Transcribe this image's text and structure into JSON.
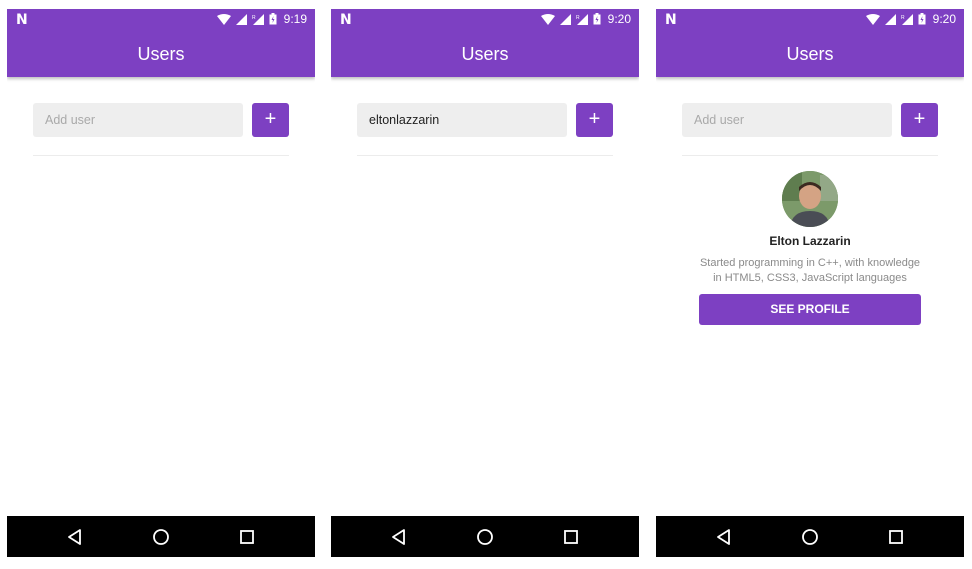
{
  "theme": {
    "primary": "#7d40c2",
    "navbar": "#000000",
    "input_bg": "#eeeeee"
  },
  "screens": [
    {
      "status": {
        "carrier_icon": "n-logo",
        "time": "9:19"
      },
      "header": {
        "title": "Users"
      },
      "form": {
        "input_value": "",
        "input_placeholder": "Add user",
        "add_label": "+"
      },
      "nav": {
        "back_icon": "back-icon",
        "home_icon": "home-icon",
        "recents_icon": "recents-icon"
      }
    },
    {
      "status": {
        "carrier_icon": "n-logo",
        "time": "9:20"
      },
      "header": {
        "title": "Users"
      },
      "form": {
        "input_value": "eltonlazzarin",
        "input_placeholder": "Add user",
        "add_label": "+"
      },
      "nav": {
        "back_icon": "back-icon",
        "home_icon": "home-icon",
        "recents_icon": "recents-icon"
      }
    },
    {
      "status": {
        "carrier_icon": "n-logo",
        "time": "9:20"
      },
      "header": {
        "title": "Users"
      },
      "form": {
        "input_value": "",
        "input_placeholder": "Add user",
        "add_label": "+"
      },
      "user_card": {
        "name": "Elton Lazzarin",
        "bio": "Started programming in C++, with knowledge in HTML5, CSS3, JavaScript languages and…",
        "button_label": "SEE PROFILE"
      },
      "nav": {
        "back_icon": "back-icon",
        "home_icon": "home-icon",
        "recents_icon": "recents-icon"
      }
    }
  ]
}
